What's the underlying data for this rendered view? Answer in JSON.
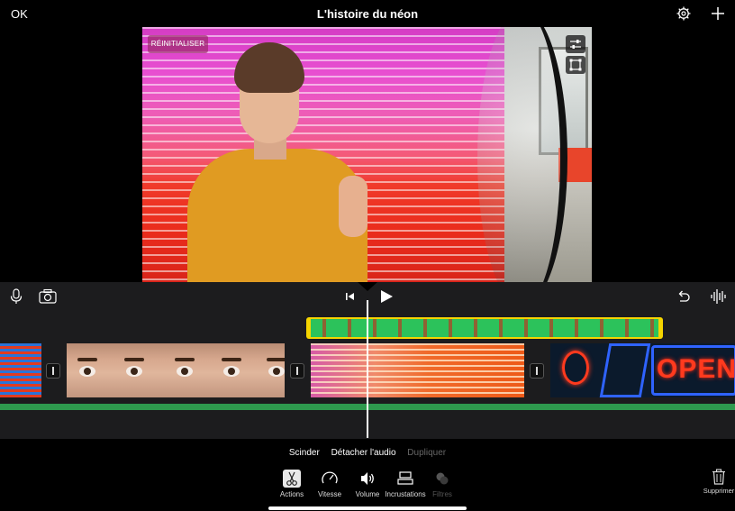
{
  "header": {
    "ok_label": "OK",
    "title": "L'histoire du néon",
    "settings_icon": "gear-icon",
    "add_icon": "plus-icon"
  },
  "viewer": {
    "reset_label": "RÉINITIALISER",
    "adjust_icon": "sliders-icon",
    "crop_icon": "crop-frame-icon"
  },
  "timeline_toolbar": {
    "mic_icon": "microphone-icon",
    "camera_icon": "camera-icon",
    "skip_back_icon": "skip-to-start-icon",
    "play_icon": "play-icon",
    "undo_icon": "undo-icon",
    "waveform_icon": "audio-waveform-icon"
  },
  "action_tabs": [
    {
      "label": "Scinder",
      "enabled": true
    },
    {
      "label": "Détacher l'audio",
      "enabled": true
    },
    {
      "label": "Dupliquer",
      "enabled": false
    }
  ],
  "tools": [
    {
      "label": "Actions",
      "icon": "scissors-icon",
      "active": true,
      "enabled": true
    },
    {
      "label": "Vitesse",
      "icon": "speedometer-icon",
      "active": false,
      "enabled": true
    },
    {
      "label": "Volume",
      "icon": "speaker-icon",
      "active": false,
      "enabled": true
    },
    {
      "label": "Incrustations",
      "icon": "overlay-layers-icon",
      "active": false,
      "enabled": true
    },
    {
      "label": "Filtres",
      "icon": "filters-icon",
      "active": false,
      "enabled": false
    }
  ],
  "delete_label": "Supprimer",
  "colors": {
    "accent_yellow": "#f5d400",
    "audio_green": "#2e9a4e",
    "background": "#1c1c1e"
  }
}
